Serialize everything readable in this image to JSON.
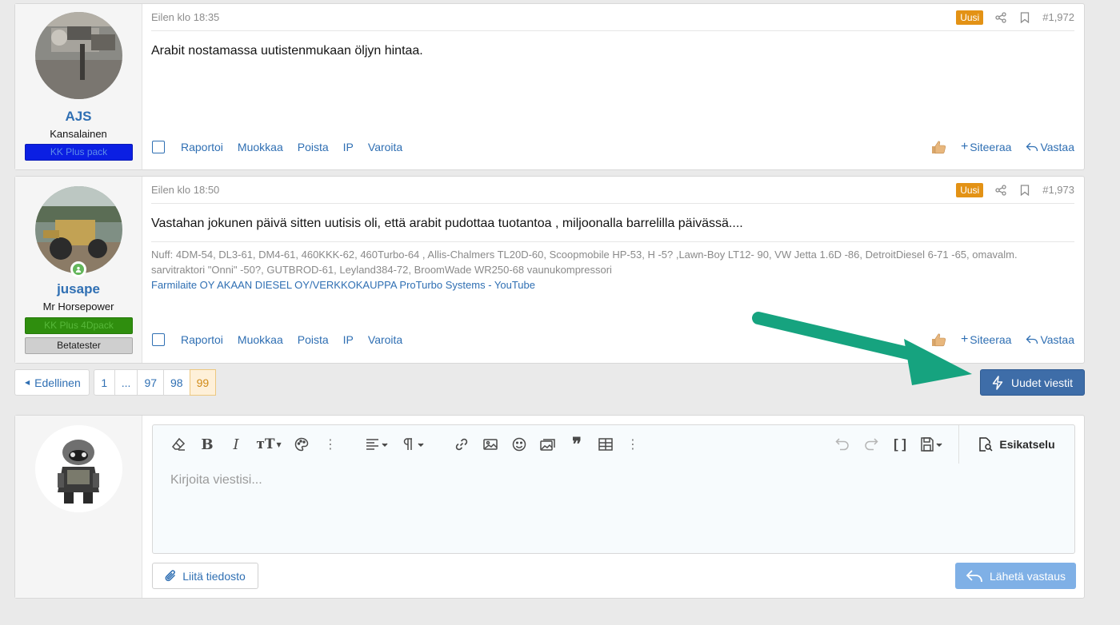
{
  "posts": [
    {
      "username": "AJS",
      "user_title": "Kansalainen",
      "banners": [
        "KK Plus pack"
      ],
      "date": "Eilen klo 18:35",
      "badge": "Uusi",
      "number": "#1,972",
      "body": "Arabit nostamassa uutistenmukaan öljyn hintaa.",
      "actions": [
        "Raportoi",
        "Muokkaa",
        "Poista",
        "IP",
        "Varoita"
      ],
      "quote_label": "Siteeraa",
      "reply_label": "Vastaa"
    },
    {
      "username": "jusape",
      "user_title": "Mr Horsepower",
      "banners": [
        "KK Plus 4Dpack",
        "Betatester"
      ],
      "date": "Eilen klo 18:50",
      "badge": "Uusi",
      "number": "#1,973",
      "body": "Vastahan jokunen päivä sitten uutisis oli, että arabit pudottaa tuotantoa , miljoonalla barrelilla päivässä....",
      "signature_line1": "Nuff: 4DM-54, DL3-61, DM4-61, 460KKK-62, 460Turbo-64 , Allis-Chalmers TL20D-60, Scoopmobile HP-53, H -5? ,Lawn-Boy LT12- 90, VW Jetta 1.6D -86, DetroitDiesel 6-71 -65, omavalm.",
      "signature_line2": "sarvitraktori \"Onni\" -50?, GUTBROD-61, Leyland384-72, BroomWade WR250-68 vaunukompressori",
      "signature_link": "Farmilaite OY AKAAN DIESEL OY/VERKKOKAUPPA ProTurbo Systems - YouTube",
      "actions": [
        "Raportoi",
        "Muokkaa",
        "Poista",
        "IP",
        "Varoita"
      ],
      "quote_label": "Siteeraa",
      "reply_label": "Vastaa"
    }
  ],
  "pagination": {
    "prev_label": "Edellinen",
    "pages": [
      "1",
      "...",
      "97",
      "98",
      "99"
    ],
    "current": "99"
  },
  "new_posts_label": "Uudet viestit",
  "reply_box": {
    "placeholder": "Kirjoita viestisi...",
    "preview_label": "Esikatselu",
    "attach_label": "Liitä tiedosto",
    "submit_label": "Lähetä vastaus"
  },
  "colors": {
    "accent": "#2f6fb3",
    "new_badge": "#e39215",
    "button_primary": "#3e6da8",
    "annotation_arrow": "#16a37f"
  }
}
